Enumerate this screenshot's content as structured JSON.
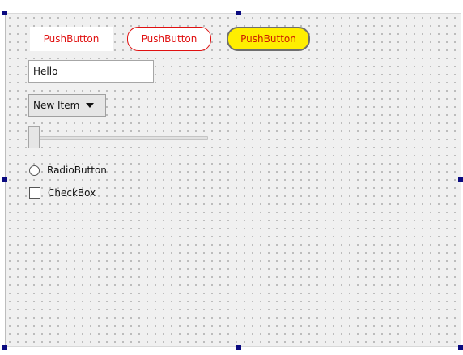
{
  "form": {
    "push_buttons": [
      {
        "label": "PushButton",
        "style": "flat-white",
        "text_color": "#e01010",
        "background": "#ffffff"
      },
      {
        "label": "PushButton",
        "style": "red-outline-rounded",
        "text_color": "#e01010",
        "border_color": "#e01010",
        "background": "#ffffff"
      },
      {
        "label": "PushButton",
        "style": "yellow-rounded",
        "text_color": "#cc1a00",
        "border_color": "#6e6e6e",
        "background": "#ffee00"
      }
    ],
    "line_edit": {
      "value": "Hello"
    },
    "combo_box": {
      "selected": "New Item"
    },
    "slider": {
      "value_fraction": 0
    },
    "radio_button": {
      "label": "RadioButton",
      "checked": false
    },
    "check_box": {
      "label": "CheckBox",
      "checked": false
    }
  },
  "colors": {
    "selection_handle": "#0a0a80",
    "form_background": "#f0f0f0",
    "grid_dot": "#9a9a9a"
  }
}
